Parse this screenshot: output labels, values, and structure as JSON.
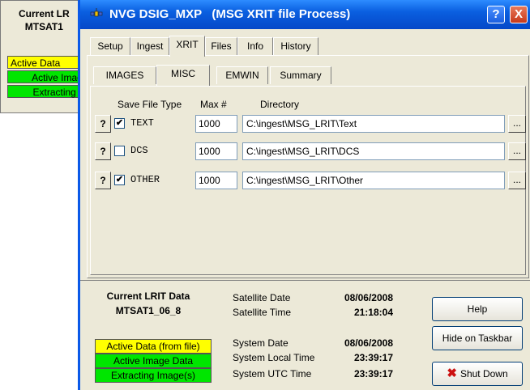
{
  "background_window": {
    "title_line1": "Current LR",
    "title_line2": "MTSAT1",
    "status1": "Active Data",
    "status2": "Active Imag",
    "status3": "Extracting I"
  },
  "window": {
    "title": "NVG DSIG_MXP   (MSG XRIT file Process)",
    "help_glyph": "?",
    "close_glyph": "X"
  },
  "tabs_main": [
    "Setup",
    "Ingest",
    "XRIT",
    "Files",
    "Info",
    "History"
  ],
  "tabs_sub": [
    "IMAGES",
    "MISC",
    "EMWIN",
    "Summary"
  ],
  "misc": {
    "headers": {
      "type": "Save File Type",
      "max": "Max #",
      "dir": "Directory"
    },
    "rows": [
      {
        "checked": "✔",
        "type": "TEXT",
        "max": "1000",
        "dir": "C:\\ingest\\MSG_LRIT\\Text"
      },
      {
        "checked": "",
        "type": "DCS",
        "max": "1000",
        "dir": "C:\\ingest\\MSG_LRIT\\DCS"
      },
      {
        "checked": "✔",
        "type": "OTHER",
        "max": "1000",
        "dir": "C:\\ingest\\MSG_LRIT\\Other"
      }
    ],
    "help_label": "?",
    "browse_label": "..."
  },
  "status": {
    "current_title": "Current LRIT Data",
    "current_name": "MTSAT1_06_8",
    "sat_date_label": "Satellite Date",
    "sat_date": "08/06/2008",
    "sat_time_label": "Satellite Time",
    "sat_time": "21:18:04",
    "sys_date_label": "System Date",
    "sys_date": "08/06/2008",
    "sys_local_label": "System Local Time",
    "sys_local": "23:39:17",
    "sys_utc_label": "System UTC Time",
    "sys_utc": "23:39:17",
    "badge_active_file": "Active Data (from file)",
    "badge_active_image": "Active Image Data",
    "badge_extracting": "Extracting Image(s)"
  },
  "buttons": {
    "help": "Help",
    "hide": "Hide on Taskbar",
    "shutdown": "Shut Down"
  },
  "colors": {
    "yellow": "#ffff00",
    "green": "#00e600",
    "title_blue": "#0a5fe0"
  }
}
